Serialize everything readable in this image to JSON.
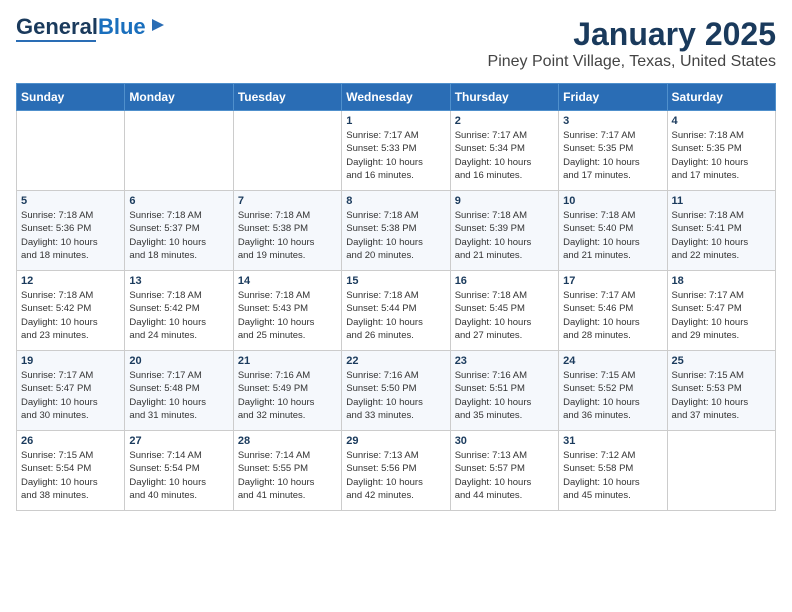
{
  "logo": {
    "part1": "General",
    "part2": "Blue"
  },
  "header": {
    "month": "January 2025",
    "location": "Piney Point Village, Texas, United States"
  },
  "weekdays": [
    "Sunday",
    "Monday",
    "Tuesday",
    "Wednesday",
    "Thursday",
    "Friday",
    "Saturday"
  ],
  "weeks": [
    [
      {
        "day": "",
        "info": ""
      },
      {
        "day": "",
        "info": ""
      },
      {
        "day": "",
        "info": ""
      },
      {
        "day": "1",
        "info": "Sunrise: 7:17 AM\nSunset: 5:33 PM\nDaylight: 10 hours\nand 16 minutes."
      },
      {
        "day": "2",
        "info": "Sunrise: 7:17 AM\nSunset: 5:34 PM\nDaylight: 10 hours\nand 16 minutes."
      },
      {
        "day": "3",
        "info": "Sunrise: 7:17 AM\nSunset: 5:35 PM\nDaylight: 10 hours\nand 17 minutes."
      },
      {
        "day": "4",
        "info": "Sunrise: 7:18 AM\nSunset: 5:35 PM\nDaylight: 10 hours\nand 17 minutes."
      }
    ],
    [
      {
        "day": "5",
        "info": "Sunrise: 7:18 AM\nSunset: 5:36 PM\nDaylight: 10 hours\nand 18 minutes."
      },
      {
        "day": "6",
        "info": "Sunrise: 7:18 AM\nSunset: 5:37 PM\nDaylight: 10 hours\nand 18 minutes."
      },
      {
        "day": "7",
        "info": "Sunrise: 7:18 AM\nSunset: 5:38 PM\nDaylight: 10 hours\nand 19 minutes."
      },
      {
        "day": "8",
        "info": "Sunrise: 7:18 AM\nSunset: 5:38 PM\nDaylight: 10 hours\nand 20 minutes."
      },
      {
        "day": "9",
        "info": "Sunrise: 7:18 AM\nSunset: 5:39 PM\nDaylight: 10 hours\nand 21 minutes."
      },
      {
        "day": "10",
        "info": "Sunrise: 7:18 AM\nSunset: 5:40 PM\nDaylight: 10 hours\nand 21 minutes."
      },
      {
        "day": "11",
        "info": "Sunrise: 7:18 AM\nSunset: 5:41 PM\nDaylight: 10 hours\nand 22 minutes."
      }
    ],
    [
      {
        "day": "12",
        "info": "Sunrise: 7:18 AM\nSunset: 5:42 PM\nDaylight: 10 hours\nand 23 minutes."
      },
      {
        "day": "13",
        "info": "Sunrise: 7:18 AM\nSunset: 5:42 PM\nDaylight: 10 hours\nand 24 minutes."
      },
      {
        "day": "14",
        "info": "Sunrise: 7:18 AM\nSunset: 5:43 PM\nDaylight: 10 hours\nand 25 minutes."
      },
      {
        "day": "15",
        "info": "Sunrise: 7:18 AM\nSunset: 5:44 PM\nDaylight: 10 hours\nand 26 minutes."
      },
      {
        "day": "16",
        "info": "Sunrise: 7:18 AM\nSunset: 5:45 PM\nDaylight: 10 hours\nand 27 minutes."
      },
      {
        "day": "17",
        "info": "Sunrise: 7:17 AM\nSunset: 5:46 PM\nDaylight: 10 hours\nand 28 minutes."
      },
      {
        "day": "18",
        "info": "Sunrise: 7:17 AM\nSunset: 5:47 PM\nDaylight: 10 hours\nand 29 minutes."
      }
    ],
    [
      {
        "day": "19",
        "info": "Sunrise: 7:17 AM\nSunset: 5:47 PM\nDaylight: 10 hours\nand 30 minutes."
      },
      {
        "day": "20",
        "info": "Sunrise: 7:17 AM\nSunset: 5:48 PM\nDaylight: 10 hours\nand 31 minutes."
      },
      {
        "day": "21",
        "info": "Sunrise: 7:16 AM\nSunset: 5:49 PM\nDaylight: 10 hours\nand 32 minutes."
      },
      {
        "day": "22",
        "info": "Sunrise: 7:16 AM\nSunset: 5:50 PM\nDaylight: 10 hours\nand 33 minutes."
      },
      {
        "day": "23",
        "info": "Sunrise: 7:16 AM\nSunset: 5:51 PM\nDaylight: 10 hours\nand 35 minutes."
      },
      {
        "day": "24",
        "info": "Sunrise: 7:15 AM\nSunset: 5:52 PM\nDaylight: 10 hours\nand 36 minutes."
      },
      {
        "day": "25",
        "info": "Sunrise: 7:15 AM\nSunset: 5:53 PM\nDaylight: 10 hours\nand 37 minutes."
      }
    ],
    [
      {
        "day": "26",
        "info": "Sunrise: 7:15 AM\nSunset: 5:54 PM\nDaylight: 10 hours\nand 38 minutes."
      },
      {
        "day": "27",
        "info": "Sunrise: 7:14 AM\nSunset: 5:54 PM\nDaylight: 10 hours\nand 40 minutes."
      },
      {
        "day": "28",
        "info": "Sunrise: 7:14 AM\nSunset: 5:55 PM\nDaylight: 10 hours\nand 41 minutes."
      },
      {
        "day": "29",
        "info": "Sunrise: 7:13 AM\nSunset: 5:56 PM\nDaylight: 10 hours\nand 42 minutes."
      },
      {
        "day": "30",
        "info": "Sunrise: 7:13 AM\nSunset: 5:57 PM\nDaylight: 10 hours\nand 44 minutes."
      },
      {
        "day": "31",
        "info": "Sunrise: 7:12 AM\nSunset: 5:58 PM\nDaylight: 10 hours\nand 45 minutes."
      },
      {
        "day": "",
        "info": ""
      }
    ]
  ]
}
